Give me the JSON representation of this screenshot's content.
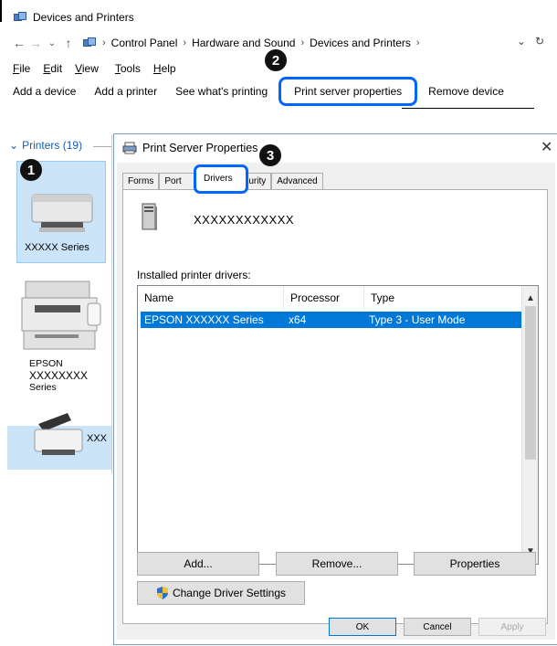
{
  "window": {
    "title": "Devices and Printers"
  },
  "address": {
    "breadcrumb": [
      "Control Panel",
      "Hardware and Sound",
      "Devices and Printers"
    ]
  },
  "menu": {
    "items": [
      "File",
      "Edit",
      "View",
      "Tools",
      "Help"
    ]
  },
  "toolbar": {
    "add_device": "Add a device",
    "add_printer": "Add a printer",
    "see_printing": "See what's printing",
    "print_server": "Print server properties",
    "remove_device": "Remove device"
  },
  "left_pane": {
    "header": "Printers (19)",
    "printer1_label": "XXXXX Series",
    "printer2_label_line1": "EPSON",
    "printer2_label_line2": "XXXXXXXX",
    "printer2_label_line3": "Series",
    "printer3_fragment": "XXX"
  },
  "badges": [
    "1",
    "2",
    "3"
  ],
  "dialog": {
    "title": "Print Server Properties",
    "close": "✕",
    "tabs": [
      "Forms",
      "Port",
      "Drivers",
      "curity",
      "Advanced"
    ],
    "server_name": "XXXXXXXXXXXX",
    "installed_label": "Installed printer drivers:",
    "columns": [
      "Name",
      "Processor",
      "Type"
    ],
    "rows": [
      {
        "name": "EPSON XXXXXX Series",
        "processor": "x64",
        "type": "Type 3 - User Mode"
      }
    ],
    "buttons": {
      "add": "Add...",
      "remove": "Remove...",
      "properties": "Properties",
      "change": "Change Driver Settings",
      "ok": "OK",
      "cancel": "Cancel",
      "apply": "Apply"
    }
  },
  "colors": {
    "accent": "#0066ff",
    "selection": "#0078d7",
    "selected_tile": "#cce4f7"
  }
}
